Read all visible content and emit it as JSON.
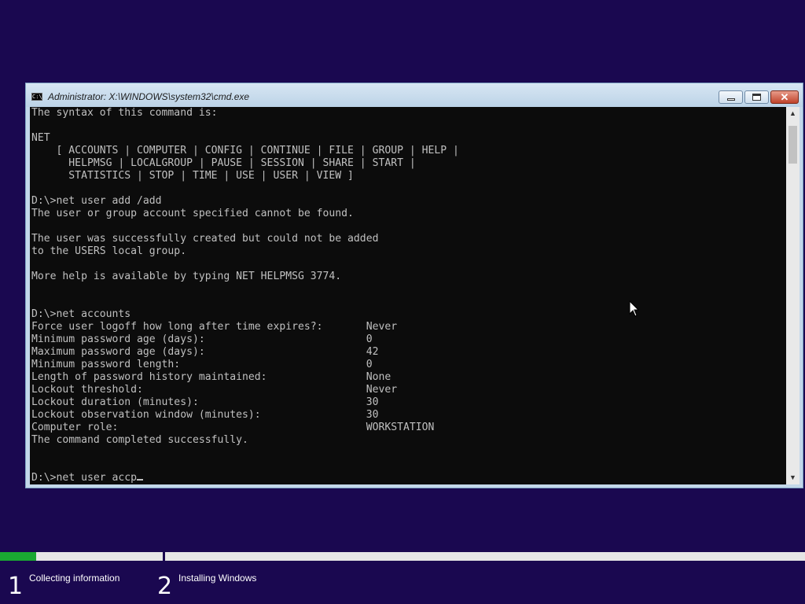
{
  "window": {
    "title": "Administrator: X:\\WINDOWS\\system32\\cmd.exe",
    "app_icon_text": "C:\\",
    "buttons": {
      "minimize": "minimize-icon",
      "maximize": "maximize-icon",
      "close": "close-icon"
    }
  },
  "console": {
    "lines": [
      "The syntax of this command is:",
      "",
      "NET",
      "    [ ACCOUNTS | COMPUTER | CONFIG | CONTINUE | FILE | GROUP | HELP |",
      "      HELPMSG | LOCALGROUP | PAUSE | SESSION | SHARE | START |",
      "      STATISTICS | STOP | TIME | USE | USER | VIEW ]",
      "",
      "D:\\>net user add /add",
      "The user or group account specified cannot be found.",
      "",
      "The user was successfully created but could not be added",
      "to the USERS local group.",
      "",
      "More help is available by typing NET HELPMSG 3774.",
      "",
      "",
      "D:\\>net accounts",
      "Force user logoff how long after time expires?:       Never",
      "Minimum password age (days):                          0",
      "Maximum password age (days):                          42",
      "Minimum password length:                              0",
      "Length of password history maintained:                None",
      "Lockout threshold:                                    Never",
      "Lockout duration (minutes):                           30",
      "Lockout observation window (minutes):                 30",
      "Computer role:                                        WORKSTATION",
      "The command completed successfully.",
      "",
      ""
    ],
    "prompt": "D:\\>",
    "current_input": "net user accp"
  },
  "setup": {
    "step1": {
      "number": "1",
      "label": "Collecting information",
      "progress": 0.22
    },
    "step2": {
      "number": "2",
      "label": "Installing Windows",
      "progress": 0
    },
    "colors": {
      "progress_fill": "#1aa832",
      "background": "#1a0850"
    }
  }
}
